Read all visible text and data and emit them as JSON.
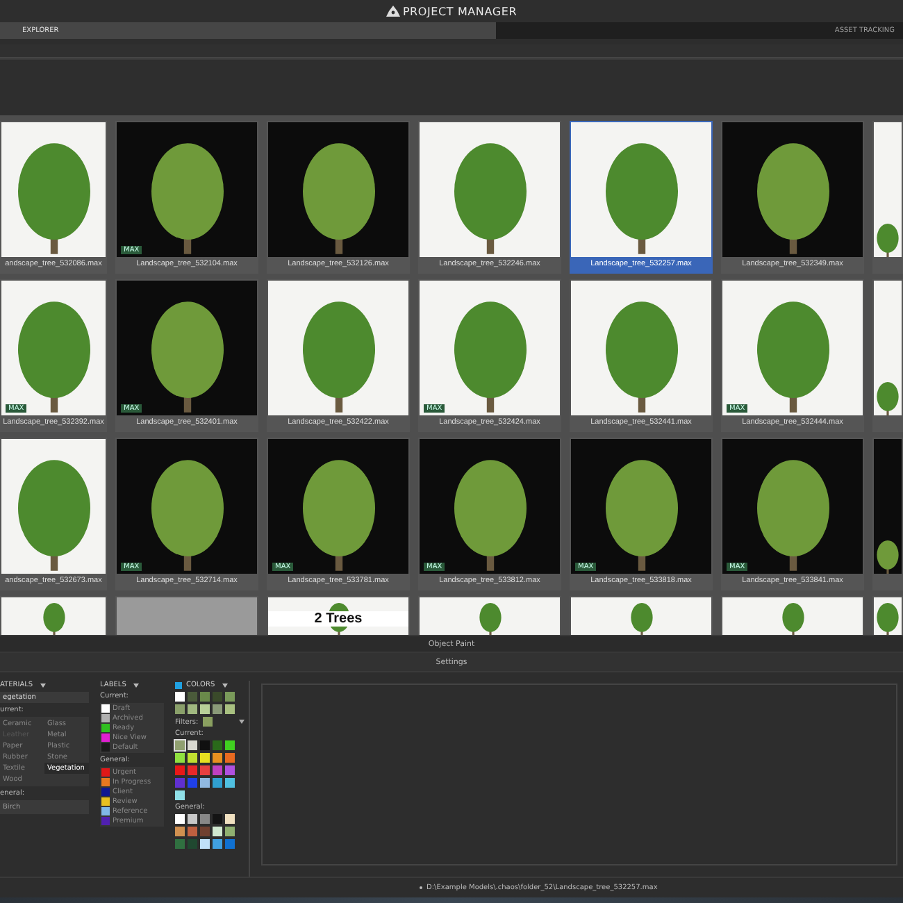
{
  "window": {
    "title": "PROJECT MANAGER"
  },
  "tabs": [
    {
      "label": "EXPLORER",
      "selected": true
    },
    {
      "label": "ASSET TRACKING",
      "selected": false
    }
  ],
  "grid": {
    "rows": [
      {
        "tiles": [
          {
            "caption": "andscape_tree_532086.max",
            "selected": false,
            "kind": "light"
          },
          {
            "caption": "Landscape_tree_532104.max",
            "selected": false,
            "kind": "dark",
            "badge": "MAX"
          },
          {
            "caption": "Landscape_tree_532126.max",
            "selected": false,
            "kind": "dark"
          },
          {
            "caption": "Landscape_tree_532246.max",
            "selected": false,
            "kind": "light"
          },
          {
            "caption": "Landscape_tree_532257.max",
            "selected": true,
            "kind": "light"
          },
          {
            "caption": "Landscape_tree_532349.max",
            "selected": false,
            "kind": "dark"
          },
          {
            "selected": false,
            "kind": "light"
          }
        ]
      },
      {
        "tiles": [
          {
            "caption": "Landscape_tree_532392.max",
            "selected": false,
            "kind": "light",
            "badge": "MAX"
          },
          {
            "caption": "Landscape_tree_532401.max",
            "selected": false,
            "kind": "dark",
            "badge": "MAX"
          },
          {
            "caption": "Landscape_tree_532422.max",
            "selected": false,
            "kind": "light"
          },
          {
            "caption": "Landscape_tree_532424.max",
            "selected": false,
            "kind": "light",
            "badge": "MAX"
          },
          {
            "caption": "Landscape_tree_532441.max",
            "selected": false,
            "kind": "light"
          },
          {
            "caption": "Landscape_tree_532444.max",
            "selected": false,
            "kind": "light",
            "badge": "MAX"
          },
          {
            "selected": false,
            "kind": "light"
          }
        ]
      },
      {
        "tiles": [
          {
            "caption": "andscape_tree_532673.max",
            "selected": false,
            "kind": "light"
          },
          {
            "caption": "Landscape_tree_532714.max",
            "selected": false,
            "kind": "dark",
            "badge": "MAX"
          },
          {
            "caption": "Landscape_tree_533781.max",
            "selected": false,
            "kind": "dark",
            "badge": "MAX"
          },
          {
            "caption": "Landscape_tree_533812.max",
            "selected": false,
            "kind": "dark",
            "badge": "MAX"
          },
          {
            "caption": "Landscape_tree_533818.max",
            "selected": false,
            "kind": "dark",
            "badge": "MAX"
          },
          {
            "caption": "Landscape_tree_533841.max",
            "selected": false,
            "kind": "dark",
            "badge": "MAX"
          },
          {
            "selected": false,
            "kind": "dark"
          }
        ]
      },
      {
        "tiles": [
          {
            "selected": false,
            "kind": "light"
          },
          {
            "selected": false,
            "kind": "blank"
          },
          {
            "selected": false,
            "kind": "light",
            "overlay": "2 Trees"
          },
          {
            "selected": false,
            "kind": "light"
          },
          {
            "selected": false,
            "kind": "light"
          },
          {
            "selected": false,
            "kind": "light"
          },
          {
            "selected": false,
            "kind": "light"
          }
        ]
      }
    ]
  },
  "object_paint": "Object Paint",
  "settings": "Settings",
  "materials": {
    "title": "ATERIALS",
    "dropdown": "egetation",
    "current_label": "urrent:",
    "items": [
      {
        "label": "Ceramic",
        "selected": false,
        "disabled": false
      },
      {
        "label": "Glass",
        "selected": false,
        "disabled": false
      },
      {
        "label": "Leather",
        "selected": false,
        "disabled": true
      },
      {
        "label": "Metal",
        "selected": false,
        "disabled": false
      },
      {
        "label": "Paper",
        "selected": false,
        "disabled": false
      },
      {
        "label": "Plastic",
        "selected": false,
        "disabled": false
      },
      {
        "label": "Rubber",
        "selected": false,
        "disabled": false
      },
      {
        "label": "Stone",
        "selected": false,
        "disabled": false
      },
      {
        "label": "Textile",
        "selected": false,
        "disabled": false
      },
      {
        "label": "Vegetation",
        "selected": true,
        "disabled": false
      },
      {
        "label": "Wood",
        "selected": false,
        "disabled": false
      }
    ],
    "general_label": "eneral:",
    "general_value": "Birch"
  },
  "labels": {
    "title": "LABELS",
    "current_label": "Current:",
    "current": [
      {
        "label": "Draft",
        "color": "#ffffff"
      },
      {
        "label": "Archived",
        "color": "#b0b0b0"
      },
      {
        "label": "Ready",
        "color": "#30c020"
      },
      {
        "label": "Nice View",
        "color": "#e020d0"
      },
      {
        "label": "Default",
        "color": "#1c1c1c"
      }
    ],
    "general_label": "General:",
    "general": [
      {
        "label": "Urgent",
        "color": "#e01818"
      },
      {
        "label": "In Progress",
        "color": "#e87820"
      },
      {
        "label": "Client",
        "color": "#101890"
      },
      {
        "label": "Review",
        "color": "#e8c020"
      },
      {
        "label": "Reference",
        "color": "#80b8e8"
      },
      {
        "label": "Premium",
        "color": "#5020b0"
      }
    ]
  },
  "colors": {
    "title": "COLORS",
    "enabled": true,
    "top": [
      {
        "color": "#ffffff"
      },
      {
        "color": "#4a5a3a"
      },
      {
        "color": "#6a8a4a"
      },
      {
        "color": "#3a4a2a"
      },
      {
        "color": "#7a9a5a"
      },
      {
        "color": "#8aa06a"
      },
      {
        "color": "#a0b880"
      },
      {
        "color": "#b8d098"
      },
      {
        "color": "#8a9a78"
      },
      {
        "color": "#a8c080"
      }
    ],
    "filters_label": "Filters:",
    "filter": {
      "color": "#8aa060"
    },
    "current_label": "Current:",
    "current": [
      {
        "color": "#90a070",
        "selected": true
      },
      {
        "color": "#d8d8d0",
        "selected": false
      },
      {
        "color": "#101010",
        "selected": false
      },
      {
        "color": "#2a6a1a",
        "selected": false
      },
      {
        "color": "#40d020",
        "selected": false
      },
      {
        "color": "#90e040",
        "selected": false
      },
      {
        "color": "#c0e030",
        "selected": false
      },
      {
        "color": "#e8e020",
        "selected": false
      },
      {
        "color": "#e89020",
        "selected": false
      },
      {
        "color": "#e86a20",
        "selected": false
      },
      {
        "color": "#e81818",
        "selected": false
      },
      {
        "color": "#e82828",
        "selected": false
      },
      {
        "color": "#e84040",
        "selected": false
      },
      {
        "color": "#c040c0",
        "selected": false
      },
      {
        "color": "#b050e0",
        "selected": false
      },
      {
        "color": "#6030d0",
        "selected": false
      },
      {
        "color": "#2040e8",
        "selected": false
      },
      {
        "color": "#90b8e0",
        "selected": false
      },
      {
        "color": "#30a0d0",
        "selected": false
      },
      {
        "color": "#50c0e0",
        "selected": false
      },
      {
        "color": "#90e0e8",
        "selected": false
      }
    ],
    "general_label": "General:",
    "general": [
      {
        "color": "#ffffff"
      },
      {
        "color": "#c8c8c8"
      },
      {
        "color": "#888888"
      },
      {
        "color": "#141414"
      },
      {
        "color": "#f0e0c0"
      },
      {
        "color": "#d09050"
      },
      {
        "color": "#c06040"
      },
      {
        "color": "#704030"
      },
      {
        "color": "#d0e8d0"
      },
      {
        "color": "#90b070"
      },
      {
        "color": "#307040"
      },
      {
        "color": "#204830"
      },
      {
        "color": "#c0e0f8"
      },
      {
        "color": "#40a0e0"
      },
      {
        "color": "#1070d0"
      }
    ]
  },
  "status_bar": {
    "path": "D:\\Example Models\\.chaos\\folder_52\\Landscape_tree_532257.max"
  }
}
